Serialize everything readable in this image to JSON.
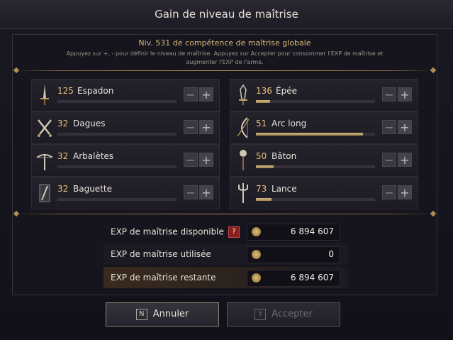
{
  "window": {
    "title": "Gain de niveau de maîtrise"
  },
  "header": {
    "global_level": "Niv. 531 de compétence de maîtrise globale",
    "instructions": "Appuyez sur +, - pour définir le niveau de maîtrise. Appuyez sur Accepter pour consommer l'EXP de maîtrise et augmenter l'EXP de l'arme."
  },
  "weapons": [
    {
      "level": "125",
      "name": "Espadon",
      "progress": 0.0,
      "icon": "greatsword-icon"
    },
    {
      "level": "136",
      "name": "Épée",
      "progress": 0.12,
      "icon": "sword-icon"
    },
    {
      "level": "32",
      "name": "Dagues",
      "progress": 0.0,
      "icon": "daggers-icon"
    },
    {
      "level": "51",
      "name": "Arc long",
      "progress": 0.9,
      "icon": "longbow-icon"
    },
    {
      "level": "32",
      "name": "Arbalètes",
      "progress": 0.0,
      "icon": "crossbow-icon"
    },
    {
      "level": "50",
      "name": "Bâton",
      "progress": 0.15,
      "icon": "staff-icon"
    },
    {
      "level": "32",
      "name": "Baguette",
      "progress": 0.0,
      "icon": "wand-icon"
    },
    {
      "level": "73",
      "name": "Lance",
      "progress": 0.13,
      "icon": "spear-icon"
    }
  ],
  "stepper": {
    "minus": "−",
    "plus": "+"
  },
  "exp": {
    "available_label": "EXP de maîtrise disponible",
    "available_help": "?",
    "available_value": "6 894 607",
    "used_label": "EXP de maîtrise utilisée",
    "used_value": "0",
    "remaining_label": "EXP de maîtrise restante",
    "remaining_value": "6 894 607"
  },
  "buttons": {
    "cancel_key": "N",
    "cancel_label": "Annuler",
    "accept_key": "Y",
    "accept_label": "Accepter"
  }
}
